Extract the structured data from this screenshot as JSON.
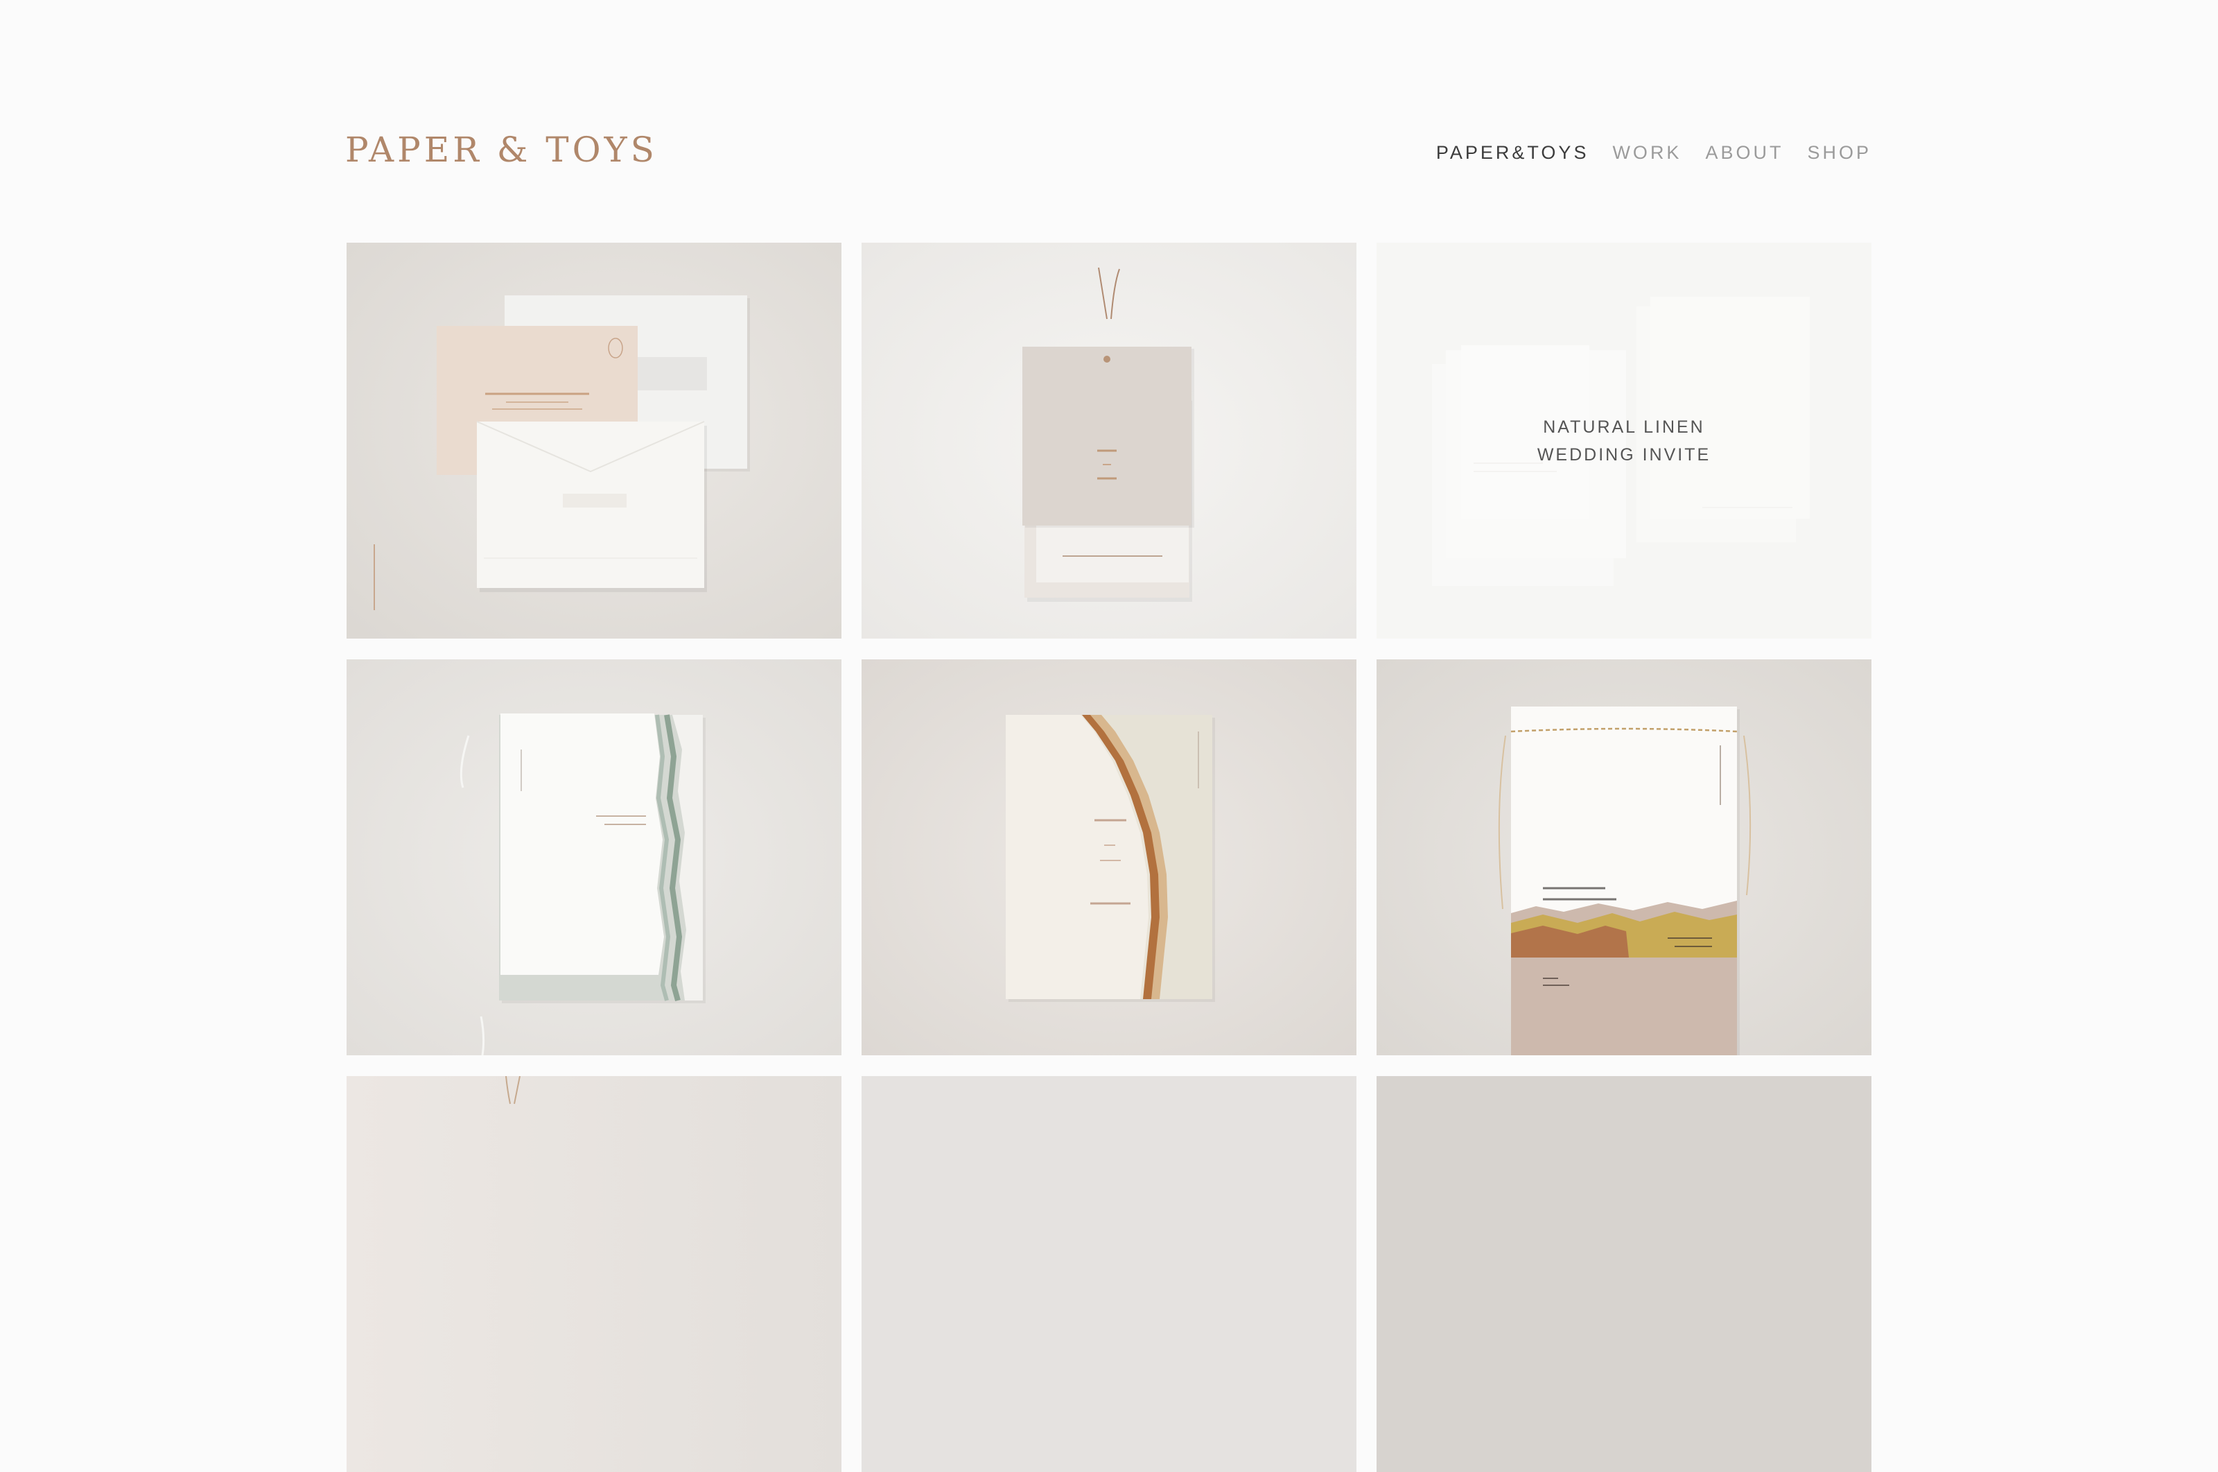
{
  "header": {
    "logo_text": "PAPER & TOYS",
    "nav": [
      {
        "label": "PAPER&TOYS",
        "active": true
      },
      {
        "label": "WORK",
        "active": false
      },
      {
        "label": "ABOUT",
        "active": false
      },
      {
        "label": "SHOP",
        "active": false
      }
    ]
  },
  "colors": {
    "background": "#fbfbfb",
    "brand": "#b0876a",
    "nav_active": "#3c3c3c",
    "nav_inactive": "#9b9b9b"
  },
  "portfolio": {
    "hovered_item_title": "NATURAL LINEN WEDDING INVITE",
    "items": [
      {
        "image": "envelope-and-linen-pouch-invite"
      },
      {
        "image": "save-the-date-tag-with-ribbon"
      },
      {
        "image": "natural-linen-wedding-invite"
      },
      {
        "image": "torn-edge-sage-invitation"
      },
      {
        "image": "torn-rust-edge-invitation"
      },
      {
        "image": "layered-torn-gold-invitation"
      },
      {
        "image": "partially-visible-item"
      },
      {
        "image": "partially-visible-item"
      },
      {
        "image": "partially-visible-item"
      }
    ]
  }
}
